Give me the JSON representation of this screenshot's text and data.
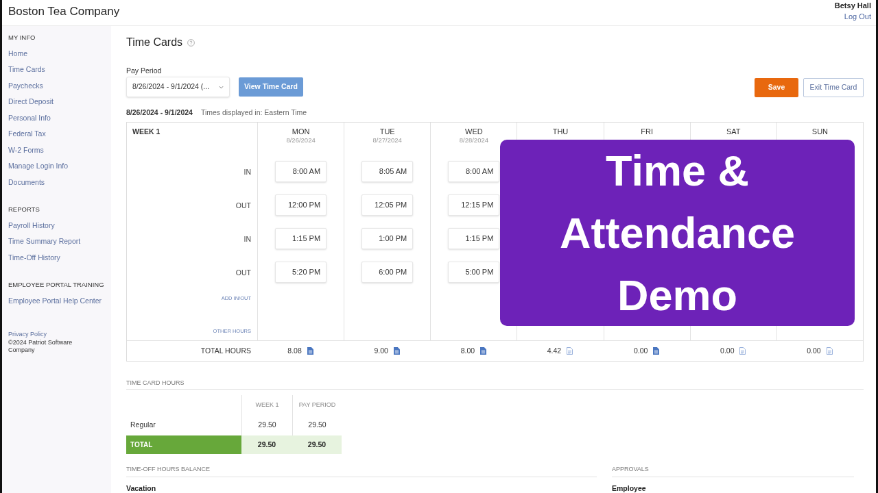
{
  "header": {
    "company": "Boston Tea Company",
    "user": "Betsy Hall",
    "logout": "Log Out"
  },
  "sidebar": {
    "sections": [
      {
        "heading": "MY INFO",
        "items": [
          "Home",
          "Time Cards",
          "Paychecks",
          "Direct Deposit",
          "Personal Info",
          "Federal Tax",
          "W-2 Forms",
          "Manage Login Info",
          "Documents"
        ]
      },
      {
        "heading": "REPORTS",
        "items": [
          "Payroll History",
          "Time Summary Report",
          "Time-Off History"
        ]
      },
      {
        "heading": "EMPLOYEE PORTAL TRAINING",
        "items": [
          "Employee Portal Help Center"
        ]
      }
    ],
    "privacy_link": "Privacy Policy",
    "copyright": "©2024 Patriot Software Company"
  },
  "page": {
    "title": "Time Cards",
    "pay_period_label": "Pay Period",
    "pay_period_value": "8/26/2024 - 9/1/2024 (...",
    "view_button": "View Time Card",
    "save_button": "Save",
    "exit_button": "Exit Time Card"
  },
  "timecard": {
    "range": "8/26/2024 - 9/1/2024",
    "timezone_note": "Times displayed in: Eastern Time",
    "week_label": "WEEK 1",
    "row_labels": [
      "IN",
      "OUT",
      "IN",
      "OUT"
    ],
    "add_link": "ADD IN/OUT",
    "other_hours_link": "OTHER HOURS",
    "total_label": "TOTAL HOURS",
    "days": [
      {
        "name": "MON",
        "date": "8/26/2024",
        "times": [
          "8:00 AM",
          "12:00 PM",
          "1:15 PM",
          "5:20 PM"
        ],
        "total": "8.08",
        "note": true
      },
      {
        "name": "TUE",
        "date": "8/27/2024",
        "times": [
          "8:05 AM",
          "12:05 PM",
          "1:00 PM",
          "6:00 PM"
        ],
        "total": "9.00",
        "note": true
      },
      {
        "name": "WED",
        "date": "8/28/2024",
        "times": [
          "8:00 AM",
          "12:15 PM",
          "1:15 PM",
          "5:00 PM"
        ],
        "total": "8.00",
        "note": true
      },
      {
        "name": "THU",
        "total": "4.42",
        "note": false
      },
      {
        "name": "FRI",
        "total": "0.00",
        "note": true
      },
      {
        "name": "SAT",
        "total": "0.00",
        "note": false
      },
      {
        "name": "SUN",
        "total": "0.00",
        "note": false
      }
    ]
  },
  "overlay": {
    "title": "Time & Attendance Demo"
  },
  "hours_summary": {
    "heading": "TIME CARD HOURS",
    "columns": [
      "WEEK 1",
      "PAY PERIOD"
    ],
    "rows": [
      {
        "kind": "regular",
        "label": "Regular",
        "values": [
          "29.50",
          "29.50"
        ]
      },
      {
        "kind": "total",
        "label": "TOTAL",
        "values": [
          "29.50",
          "29.50"
        ]
      }
    ]
  },
  "time_off": {
    "heading": "TIME-OFF HOURS BALANCE",
    "items": [
      "Vacation"
    ]
  },
  "approvals": {
    "heading": "APPROVALS",
    "items": [
      "Employee"
    ]
  }
}
